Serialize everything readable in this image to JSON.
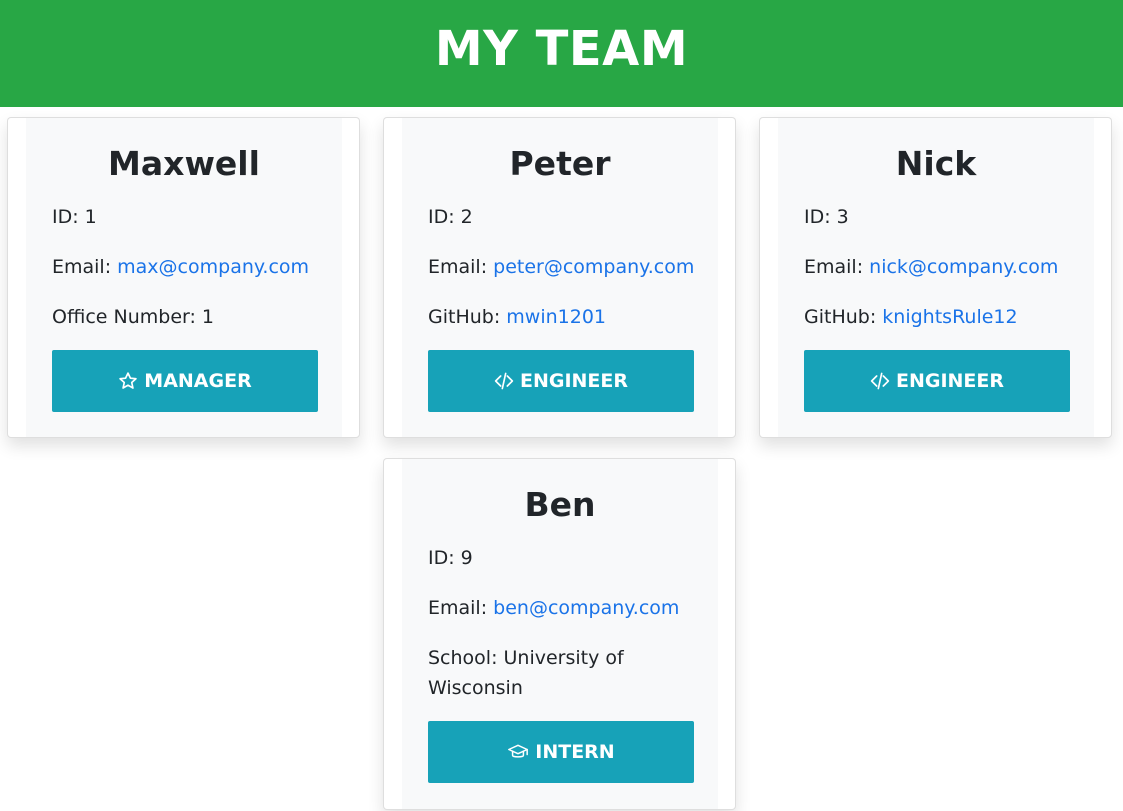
{
  "header": {
    "title": "MY TEAM"
  },
  "employees": [
    {
      "name": "Maxwell",
      "id_label": "ID: 1",
      "email_prefix": "Email: ",
      "email": "max@company.com",
      "detail_prefix": "Office Number: 1",
      "detail_value": "",
      "role": "MANAGER",
      "role_icon": "star-icon"
    },
    {
      "name": "Peter",
      "id_label": "ID: 2",
      "email_prefix": "Email: ",
      "email": "peter@company.com",
      "detail_prefix": "GitHub: ",
      "detail_value": "mwin1201",
      "role": "ENGINEER",
      "role_icon": "code-icon"
    },
    {
      "name": "Nick",
      "id_label": "ID: 3",
      "email_prefix": "Email: ",
      "email": "nick@company.com",
      "detail_prefix": "GitHub: ",
      "detail_value": "knightsRule12",
      "role": "ENGINEER",
      "role_icon": "code-icon"
    },
    {
      "name": "Ben",
      "id_label": "ID: 9",
      "email_prefix": "Email: ",
      "email": "ben@company.com",
      "detail_prefix": "School: University of Wisconsin",
      "detail_value": "",
      "role": "INTERN",
      "role_icon": "graduation-cap-icon"
    }
  ],
  "colors": {
    "header_bg": "#28a745",
    "button_bg": "#17a2b8",
    "link": "#1a73e8",
    "card_inner_bg": "#f8f9fa"
  }
}
